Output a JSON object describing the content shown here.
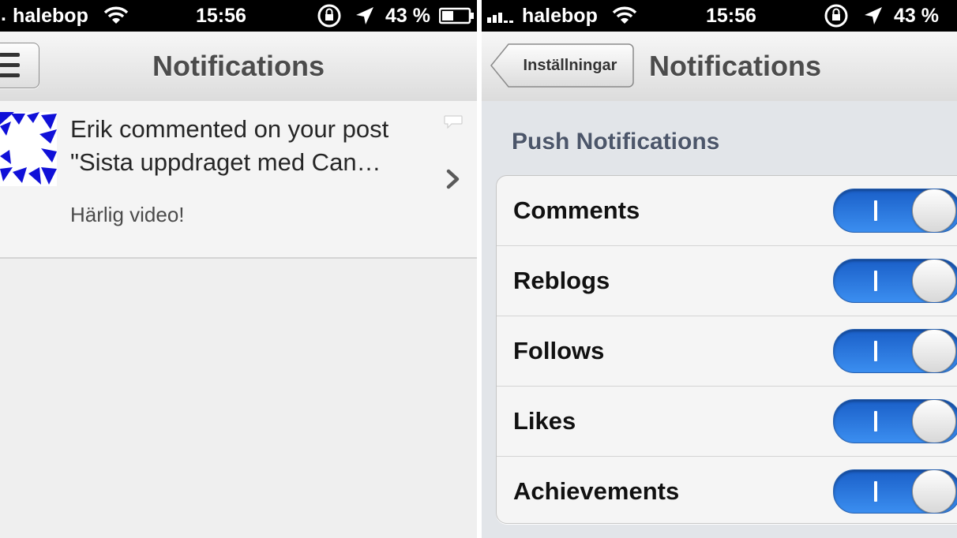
{
  "left": {
    "status": {
      "carrier": "halebop",
      "time": "15:56",
      "battery": "43 %"
    },
    "title": "Notifications",
    "notification": {
      "line1": "Erik commented on your post",
      "line2": "\"Sista uppdraget med Can…",
      "comment": "Härlig video!"
    }
  },
  "right": {
    "status": {
      "carrier": "halebop",
      "time": "15:56",
      "battery": "43 %"
    },
    "back_label": "Inställningar",
    "title": "Notifications",
    "section_header": "Push Notifications",
    "rows": [
      {
        "label": "Comments",
        "on": true
      },
      {
        "label": "Reblogs",
        "on": true
      },
      {
        "label": "Follows",
        "on": true
      },
      {
        "label": "Likes",
        "on": true
      },
      {
        "label": "Achievements",
        "on": true
      }
    ]
  },
  "colors": {
    "toggle_on": "#2f80e8",
    "section_header": "#4c566a"
  }
}
